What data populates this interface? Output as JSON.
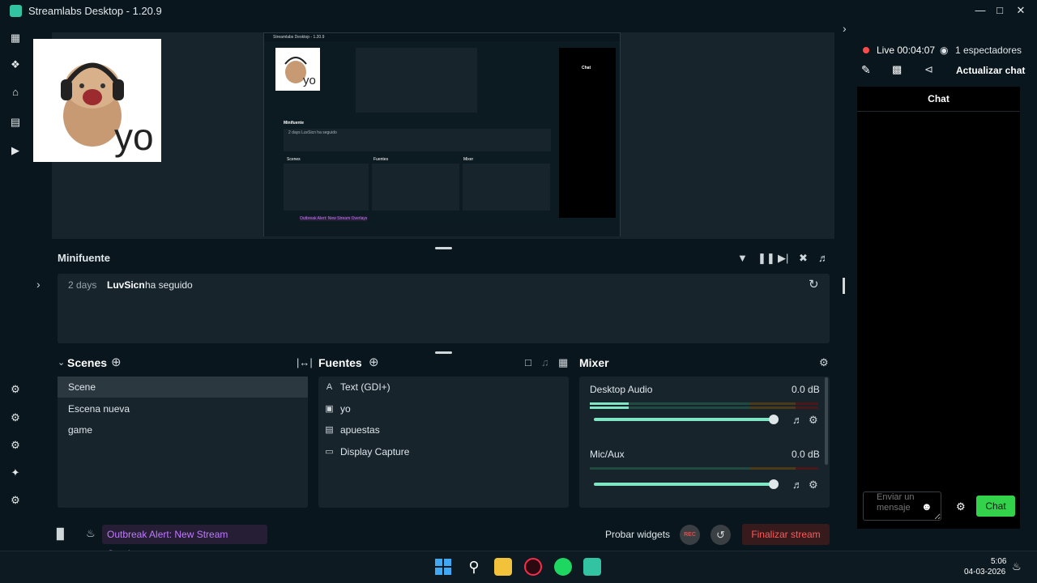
{
  "window": {
    "title": "Streamlabs Desktop - 1.20.9"
  },
  "preview": {
    "overlay_text": "yo",
    "inner": {
      "title": "Streamlabs Desktop - 1.20.9",
      "minifuente": "Minifuente",
      "event": "2 days LuvSicn ha seguido",
      "scenes": "Scenes",
      "fuentes": "Fuentes",
      "mixer": "Mixer",
      "alert": "Outbreak Alert: New Stream Overlays",
      "chat": "Chat"
    }
  },
  "minifuente": {
    "title": "Minifuente",
    "event": {
      "when": "2 days",
      "user": "LuvSicn",
      "action": "ha seguido"
    }
  },
  "scenes": {
    "title": "Scenes",
    "items": [
      "Scene",
      "Escena nueva",
      "game"
    ]
  },
  "fuentes": {
    "title": "Fuentes",
    "items": [
      {
        "label": "Text (GDI+)",
        "icon": "text-icon"
      },
      {
        "label": "yo",
        "icon": "image-icon"
      },
      {
        "label": "apuestas",
        "icon": "browser-icon"
      },
      {
        "label": "Display Capture",
        "icon": "monitor-icon"
      }
    ]
  },
  "mixer": {
    "title": "Mixer",
    "channels": [
      {
        "name": "Desktop Audio",
        "value": "0.0 dB",
        "level": 1.0
      },
      {
        "name": "Mic/Aux",
        "value": "0.0 dB",
        "level": 1.0
      }
    ]
  },
  "bottom": {
    "alert": "Outbreak Alert: New Stream Overlays",
    "probar": "Probar widgets",
    "rec": "REC",
    "end": "Finalizar stream"
  },
  "chat": {
    "live": "Live 00:04:07",
    "viewers": "1 espectadores",
    "refresh": "Actualizar chat",
    "title": "Chat",
    "placeholder": "Enviar un mensaje",
    "send": "Chat"
  },
  "taskbar": {
    "time": "5:06",
    "date": "04-03-2026"
  },
  "colors": {
    "accent": "#31c3a2",
    "live": "#ff4a4a",
    "alert": "#c079ff",
    "end": "#ff5a5a",
    "chat_send": "#32d24a",
    "fader": "#7ee6c3"
  }
}
